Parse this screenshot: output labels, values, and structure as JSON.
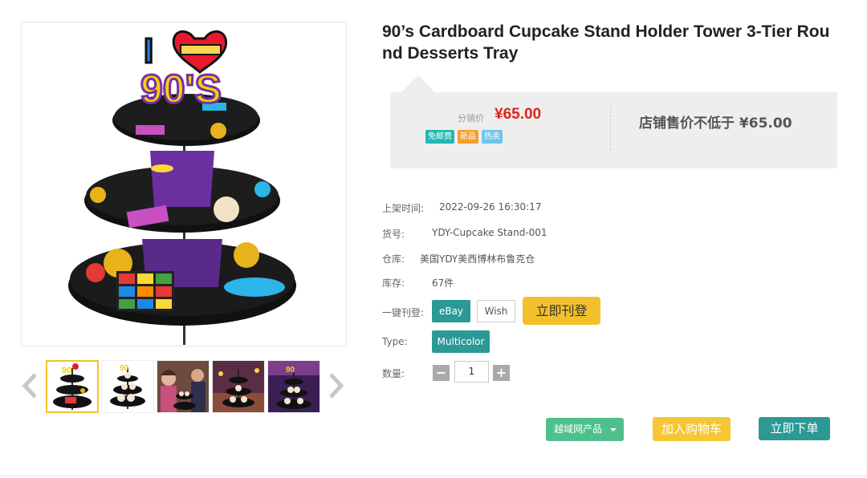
{
  "product": {
    "title": "90’s Cardboard Cupcake Stand Holder Tower 3-Tier Round Desserts Tray",
    "main_image": {
      "icon": "cupcake-stand-image",
      "topper_text_i": "I",
      "topper_text_90s": "90'S",
      "heart_color": "#e8192c"
    },
    "thumbnails": [
      {
        "icon": "cupcake-stand-thumbnail",
        "active": true
      },
      {
        "icon": "cupcake-stand-white-thumbnail",
        "active": false
      },
      {
        "icon": "party-photo-thumbnail",
        "active": false
      },
      {
        "icon": "party-photo-thumbnail",
        "active": false
      },
      {
        "icon": "party-photo-thumbnail",
        "active": false
      }
    ]
  },
  "pricing": {
    "distribution_label": "分销价",
    "distribution_price": "¥65.00",
    "tags": [
      "免邮费",
      "新品",
      "热卖"
    ],
    "store_price_text": "店铺售价不低于 ¥65.00"
  },
  "details": {
    "listed_time_label": "上架时间:",
    "listed_time": "2022-09-26 16:30:17",
    "sku_label": "货号:",
    "sku": "YDY-Cupcake Stand-001",
    "warehouse_label": "仓库:",
    "warehouse": "美国YDY美西博林布鲁克仓",
    "stock_label": "库存:",
    "stock": "67件",
    "one_click_label": "一键刊登:",
    "platforms": [
      "eBay",
      "Wish"
    ],
    "list_now_label": "立即刊登",
    "type_label": "Type:",
    "type_value": "Multicolor",
    "qty_label": "数量:",
    "qty_value": "1",
    "qty_minus": "−",
    "qty_plus": "+"
  },
  "actions": {
    "cross_border_label": "越域网产品",
    "add_cart_label": "加入购物车",
    "buy_now_label": "立即下单"
  },
  "colors": {
    "accent_teal": "#2b9a95",
    "price_red": "#e2231a",
    "yellow": "#f3c02d",
    "green": "#4fc08d"
  }
}
